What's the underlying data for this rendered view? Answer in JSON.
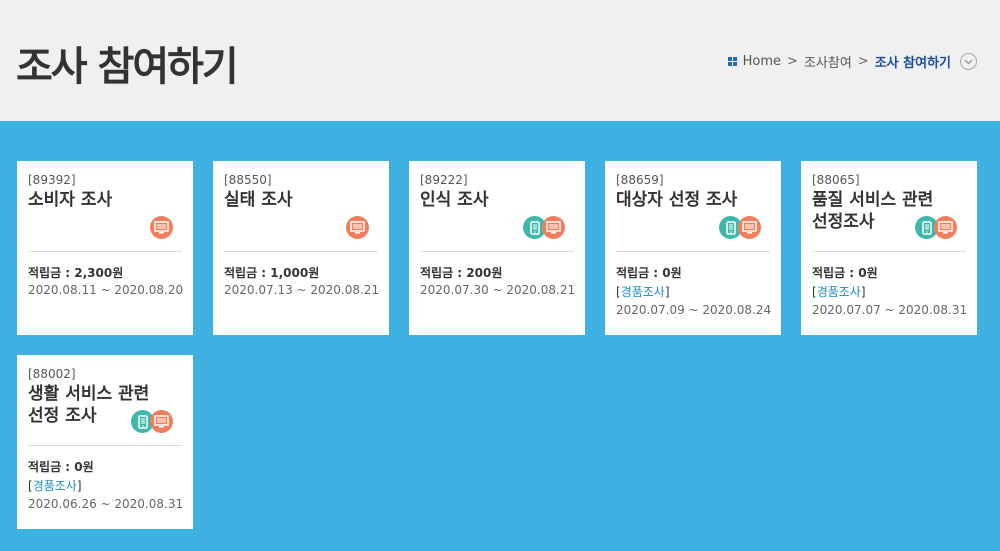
{
  "page": {
    "title": "조사 참여하기"
  },
  "breadcrumb": {
    "home": "Home",
    "sep": ">",
    "parent": "조사참여",
    "current": "조사 참여하기",
    "toggle_icon": "chevron-down-icon"
  },
  "surveys": [
    {
      "id": "[89392]",
      "title": "소비자 조사",
      "icons": [
        "pc"
      ],
      "points": "적립금 : 2,300원",
      "gift": null,
      "dates": "2020.08.11 ~ 2020.08.20"
    },
    {
      "id": "[88550]",
      "title": "실태 조사",
      "icons": [
        "pc"
      ],
      "points": "적립금 : 1,000원",
      "gift": null,
      "dates": "2020.07.13 ~ 2020.08.21"
    },
    {
      "id": "[89222]",
      "title": "인식 조사",
      "icons": [
        "mobile",
        "pc"
      ],
      "points": "적립금 : 200원",
      "gift": null,
      "dates": "2020.07.30 ~ 2020.08.21"
    },
    {
      "id": "[88659]",
      "title": "대상자 선정 조사",
      "icons": [
        "mobile",
        "pc"
      ],
      "points": "적립금 : 0원",
      "gift": "경품조사",
      "dates": "2020.07.09 ~ 2020.08.24"
    },
    {
      "id": "[88065]",
      "title": "품질 서비스 관련 선정조사",
      "icons": [
        "mobile",
        "pc"
      ],
      "points": "적립금 : 0원",
      "gift": "경품조사",
      "dates": "2020.07.07 ~ 2020.08.31"
    },
    {
      "id": "[88002]",
      "title": "생활 서비스 관련 선정 조사",
      "icons": [
        "mobile",
        "pc"
      ],
      "points": "적립금 : 0원",
      "gift": "경품조사",
      "dates": "2020.06.26 ~ 2020.08.31"
    }
  ],
  "colors": {
    "background": "#3eb0e2",
    "pc_icon": "#ef7e5c",
    "mobile_icon": "#3fb8ab",
    "gift_link": "#1a8cc0"
  }
}
